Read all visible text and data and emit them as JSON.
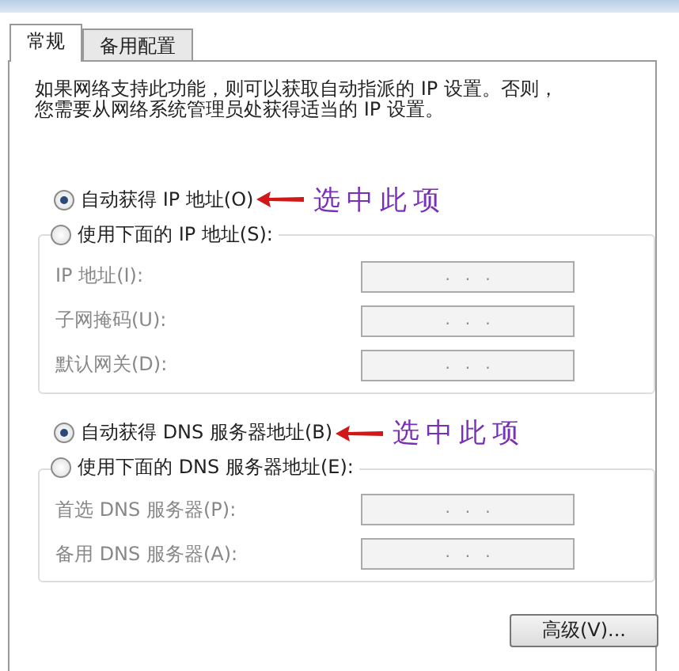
{
  "tabs": [
    {
      "label": "常规",
      "selected": true
    },
    {
      "label": "备用配置",
      "selected": false
    }
  ],
  "description": [
    "如果网络支持此功能，则可以获取自动指派的 IP 设置。否则，",
    "您需要从网络系统管理员处获得适当的 IP 设置。"
  ],
  "sections": [
    {
      "auto": {
        "label": "自动获得 IP 地址(O)",
        "selected": true,
        "note": "选中此项"
      },
      "manual": {
        "label": "使用下面的 IP 地址(S):",
        "selected": false
      },
      "fields": [
        {
          "label": "IP 地址(I):",
          "value": ".   .   .",
          "disabled": true
        },
        {
          "label": "子网掩码(U):",
          "value": ".   .   .",
          "disabled": true
        },
        {
          "label": "默认网关(D):",
          "value": ".   .   .",
          "disabled": true
        }
      ]
    },
    {
      "auto": {
        "label": "自动获得 DNS 服务器地址(B)",
        "selected": true,
        "note": "选中此项"
      },
      "manual": {
        "label": "使用下面的 DNS 服务器地址(E):",
        "selected": false
      },
      "fields": [
        {
          "label": "首选 DNS 服务器(P):",
          "value": ".   .   .",
          "disabled": true
        },
        {
          "label": "备用 DNS 服务器(A):",
          "value": ".   .   .",
          "disabled": true
        }
      ]
    }
  ],
  "button": "高级(V)..."
}
